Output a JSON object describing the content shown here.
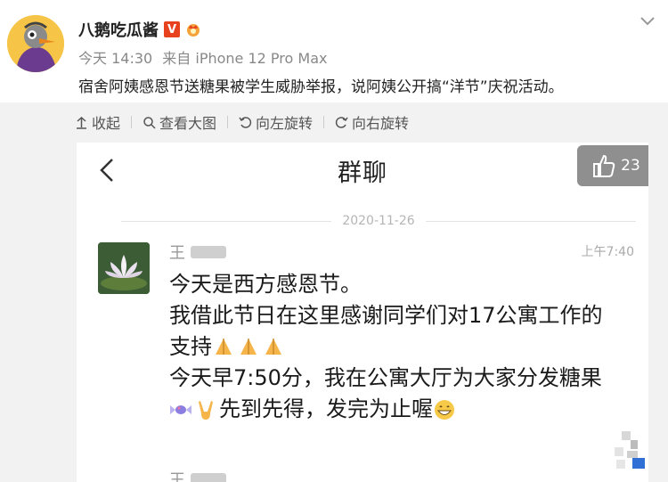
{
  "post": {
    "username": "八鹅吃瓜酱",
    "verified_badge": "V",
    "time": "今天 14:30",
    "source": "来自 iPhone 12 Pro Max",
    "text": "宿舍阿姨感恩节送糖果被学生威胁举报，说阿姨公开搞“洋节”庆祝活动。",
    "icons": {
      "avatar": "cartoon-duck-avatar",
      "badge": "crown-badge",
      "expand": "chevron-down-icon"
    }
  },
  "toolbar": {
    "collapse": "收起",
    "view_large": "查看大图",
    "rotate_left": "向左旋转",
    "rotate_right": "向右旋转"
  },
  "chat": {
    "title": "群聊",
    "likes": "23",
    "date": "2020-11-26",
    "sender": "王",
    "time": "上午7:40",
    "lines": [
      "今天是西方感恩节。",
      "我借此节日在这里感谢同学们对17公寓工作的",
      "支持",
      "今天早7:50分，我在公寓大厅为大家分发糖果",
      "先到先得，发完为止喔"
    ],
    "next_sender": "王",
    "emoji": {
      "pray": "pray-emoji",
      "candy": "candy-emoji",
      "victory": "victory-hand-emoji",
      "grin": "grin-emoji"
    }
  },
  "colors": {
    "badge_red": "#e8411d",
    "like_gray": "#8f8f8f",
    "toolbar_bg": "#f2f2f2"
  }
}
